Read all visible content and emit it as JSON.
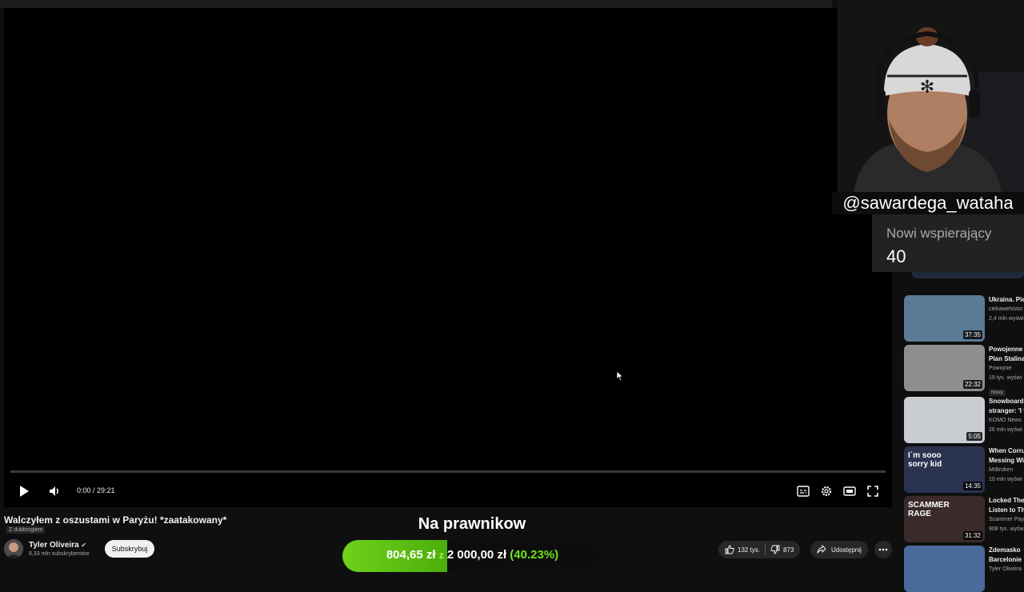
{
  "overlay": {
    "handle": "@sawardega_wataha",
    "supporters_label": "Nowi wspierający",
    "supporters_count": "40",
    "goal_title": "Na prawnikow",
    "goal_current": "804,65 zł",
    "goal_separator": "z",
    "goal_target": "2 000,00 zł",
    "goal_percent": "(40.23%)",
    "goal_progress": 0.4023
  },
  "player": {
    "time": "0:00 / 29:21",
    "progress": 0
  },
  "video": {
    "title": "Walczyłem z oszustami w Paryżu! *zaatakowany*",
    "dub_label": "Z dubbingiem",
    "channel": "Tyler Oliveira",
    "subscribers": "8,33 mln subskrybentów",
    "subscribe_label": "Subskrybuj",
    "likes": "132 tys.",
    "dislikes": "873",
    "share_label": "Udostępnij"
  },
  "recommendations": [
    {
      "title": "Ukraina. Pie",
      "channel": "ciekawehistor",
      "meta": "2,4 mln wyświ",
      "duration": "37:35",
      "color": "#5b7a96"
    },
    {
      "title": "Powojenne",
      "title2": "Plan Stalina",
      "channel": "Powojnie",
      "meta": "19 tys. wyświ",
      "badge": "Nowy",
      "duration": "22:32",
      "color": "#8e8e8e"
    },
    {
      "title": "Snowboard",
      "title2": "stranger: 'I v",
      "channel": "KOMO News",
      "meta": "26 mln wyświ",
      "duration": "5:05",
      "color": "#c9ccd0"
    },
    {
      "title": "When Corru",
      "title2": "Messing Wi",
      "channel": "MrBroken",
      "meta": "10 mln wyświ",
      "duration": "14:35",
      "color": "#2a3350",
      "thumb_text": "I`m sooo sorry kid"
    },
    {
      "title": "Locked The",
      "title2": "Listen to Th",
      "channel": "Scammer Pay",
      "meta": "908 tys. wyświ",
      "duration": "31:32",
      "color": "#3a2a2a",
      "thumb_text": "SCAMMER RAGE"
    },
    {
      "title": "Zdemasko",
      "title2": "Barcelonie",
      "channel": "Tyler Oliveira",
      "meta": "",
      "duration": "",
      "color": "#4a6a9a"
    }
  ]
}
